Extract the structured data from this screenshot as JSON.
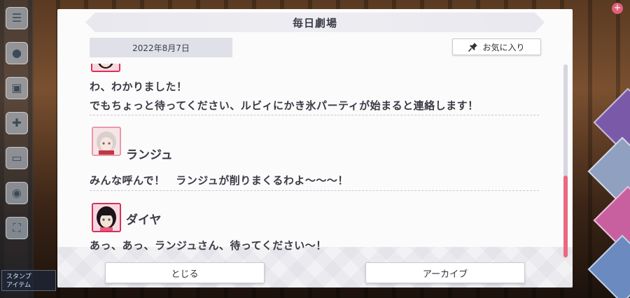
{
  "modal": {
    "title": "毎日劇場",
    "date": "2022年8月7日",
    "favorite_label": "お気に入り",
    "close_label": "とじる",
    "archive_label": "アーカイブ"
  },
  "dialogue": [
    {
      "speaker": "",
      "lines": [
        "わ、わかりました！",
        "でもちょっと待ってください、ルビィにかき氷パーティが始まると連絡します！"
      ]
    },
    {
      "speaker": "ランジュ",
      "lines": [
        "みんな呼んで！　ランジュが削りまくるわよ〜〜〜！"
      ]
    },
    {
      "speaker": "ダイヤ",
      "lines": [
        "あっ、あっ、ランジュさん、待ってください〜！"
      ]
    }
  ],
  "background": {
    "stamp_label_line1": "スタンプ",
    "stamp_label_line2": "アイテム"
  },
  "icons": {
    "menu": "menu-icon",
    "chat": "chat-icon",
    "pin": "pin-icon"
  },
  "colors": {
    "accent": "#e86a80",
    "avatar_border_dia": "#d8305a",
    "avatar_border_lanzhu": "#e89aa8"
  }
}
